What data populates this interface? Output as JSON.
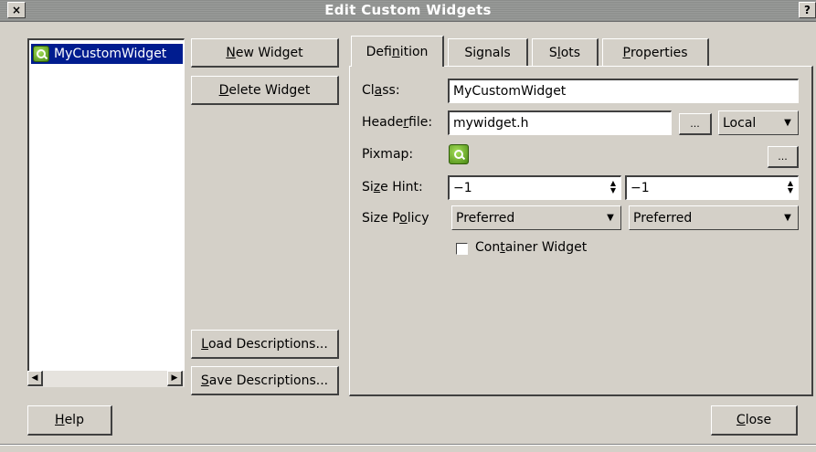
{
  "window": {
    "title": "Edit Custom Widgets",
    "close_glyph": "×",
    "help_glyph": "?"
  },
  "widget_list": {
    "items": [
      {
        "label": "MyCustomWidget",
        "icon": "qt-designer-icon",
        "selected": true
      }
    ],
    "scroll_left": "◀",
    "scroll_right": "▶"
  },
  "buttons": {
    "new_widget": {
      "mnemonic": "N",
      "rest": "ew Widget"
    },
    "delete_widget": {
      "mnemonic": "D",
      "rest": "elete Widget"
    },
    "load_descriptions": {
      "mnemonic": "L",
      "rest": "oad Descriptions..."
    },
    "save_descriptions": {
      "mnemonic": "S",
      "rest": "ave Descriptions..."
    },
    "help": {
      "mnemonic": "H",
      "rest": "elp"
    },
    "close": {
      "mnemonic": "C",
      "rest": "lose"
    }
  },
  "tabs": [
    {
      "pre": "Defi",
      "mnemonic": "n",
      "post": "ition",
      "active": true
    },
    {
      "pre": "Si",
      "mnemonic": "g",
      "post": "nals",
      "active": false
    },
    {
      "pre": "S",
      "mnemonic": "l",
      "post": "ots",
      "active": false
    },
    {
      "pre": "",
      "mnemonic": "P",
      "post": "roperties",
      "active": false
    }
  ],
  "definition": {
    "class_label": {
      "pre": "Cl",
      "mnemonic": "a",
      "post": "ss:"
    },
    "class_value": "MyCustomWidget",
    "headerfile_label": {
      "pre": "Heade",
      "mnemonic": "r",
      "post": "file:"
    },
    "headerfile_value": "mywidget.h",
    "browse_label": "...",
    "include_scope": "Local",
    "pixmap_label": "Pixmap:",
    "pixmap_browse_label": "...",
    "size_hint_label": {
      "pre": "Si",
      "mnemonic": "z",
      "post": "e Hint:"
    },
    "size_hint_width": "−1",
    "size_hint_height": "−1",
    "size_policy_label": {
      "pre": "Size P",
      "mnemonic": "o",
      "post": "licy"
    },
    "size_policy_horizontal": "Preferred",
    "size_policy_vertical": "Preferred",
    "container_label": {
      "pre": "Con",
      "mnemonic": "t",
      "post": "ainer Widget"
    },
    "container_checked": false
  },
  "colors": {
    "face": "#d4d0c8",
    "selection": "#001c8f",
    "title_text": "#ffffff"
  }
}
